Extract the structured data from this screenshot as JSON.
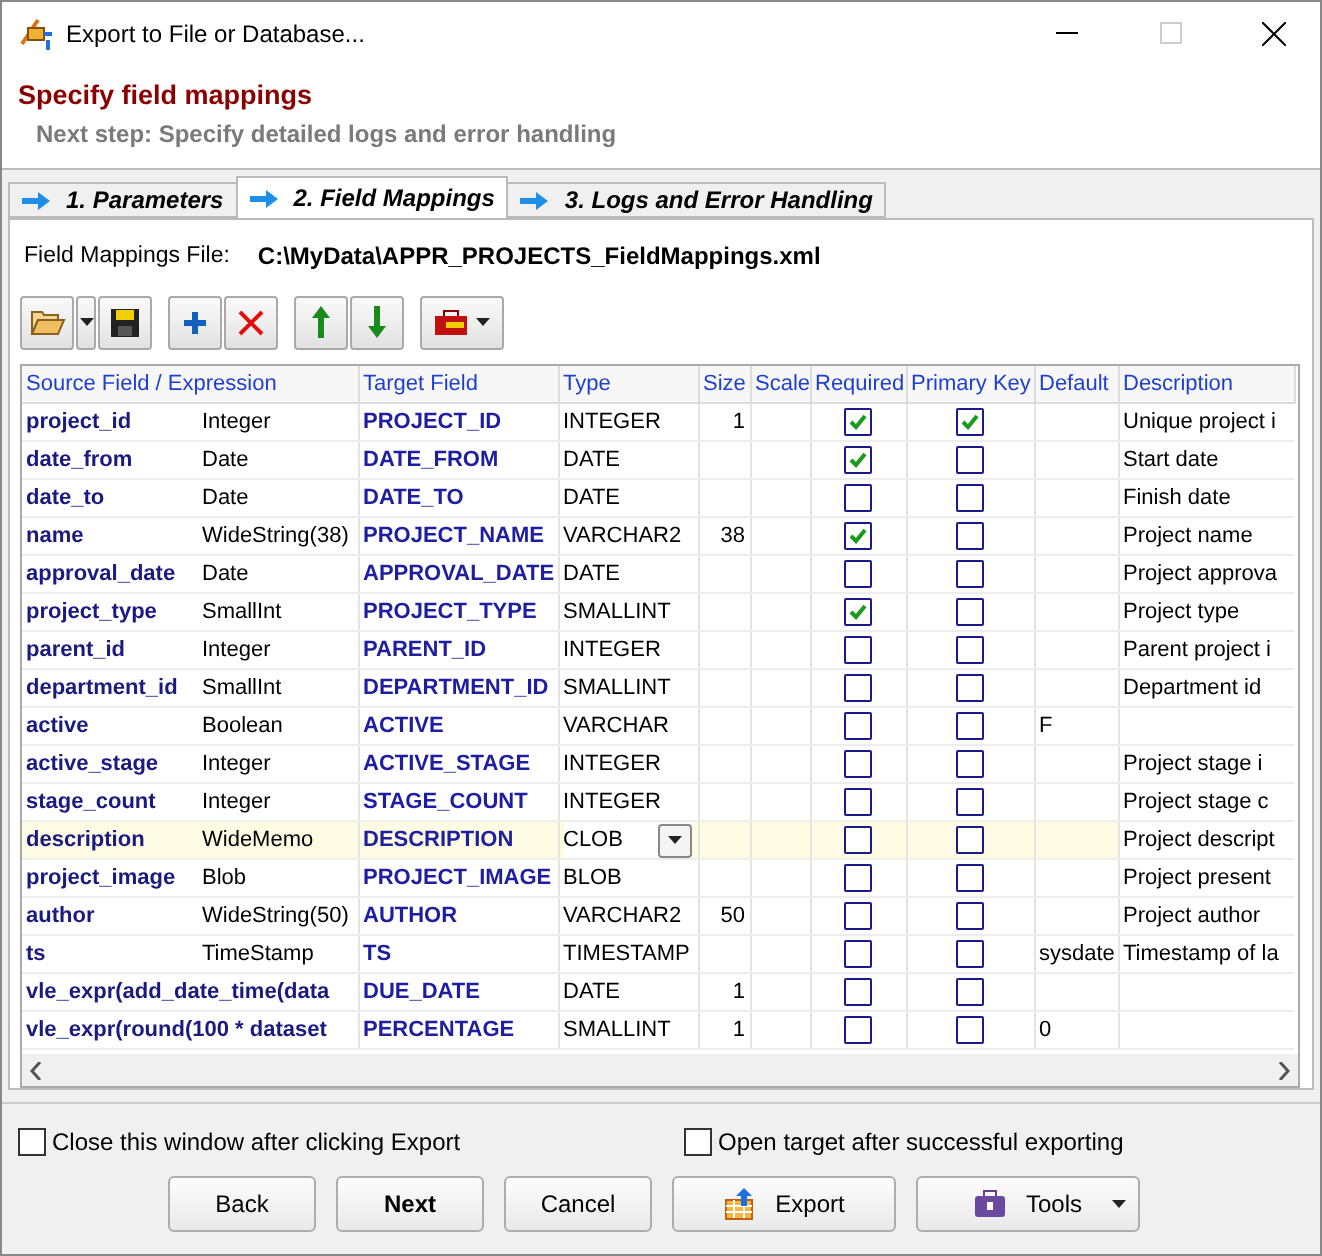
{
  "window": {
    "title": "Export to File or Database..."
  },
  "header": {
    "title": "Specify field mappings",
    "subtitle": "Next step: Specify detailed logs and error handling"
  },
  "tabs": [
    {
      "label": "1. Parameters",
      "selected": false
    },
    {
      "label": "2. Field Mappings",
      "selected": true
    },
    {
      "label": "3. Logs and Error Handling",
      "selected": false
    }
  ],
  "mappings_file": {
    "label": "Field Mappings File:",
    "value": "C:\\MyData\\APPR_PROJECTS_FieldMappings.xml"
  },
  "table": {
    "columns": [
      "Source Field / Expression",
      "Target Field",
      "Type",
      "Size",
      "Scale",
      "Required",
      "Primary Key",
      "Default",
      "Description"
    ],
    "rows": [
      {
        "source": "project_id",
        "source_type": "Integer",
        "target": "PROJECT_ID",
        "type": "INTEGER",
        "size": "1",
        "required": true,
        "primary_key": true,
        "description": "Unique project i",
        "selected": false
      },
      {
        "source": "date_from",
        "source_type": "Date",
        "target": "DATE_FROM",
        "type": "DATE",
        "required": true,
        "primary_key": false,
        "description": "Start date",
        "selected": false
      },
      {
        "source": "date_to",
        "source_type": "Date",
        "target": "DATE_TO",
        "type": "DATE",
        "required": false,
        "primary_key": false,
        "description": "Finish date",
        "selected": false
      },
      {
        "source": "name",
        "source_type": "WideString(38)",
        "target": "PROJECT_NAME",
        "type": "VARCHAR2",
        "size": "38",
        "required": true,
        "primary_key": false,
        "description": "Project name",
        "selected": false
      },
      {
        "source": "approval_date",
        "source_type": "Date",
        "target": "APPROVAL_DATE",
        "type": "DATE",
        "required": false,
        "primary_key": false,
        "description": "Project approva",
        "selected": false
      },
      {
        "source": "project_type",
        "source_type": "SmallInt",
        "target": "PROJECT_TYPE",
        "type": "SMALLINT",
        "required": true,
        "primary_key": false,
        "description": "Project type",
        "selected": false
      },
      {
        "source": "parent_id",
        "source_type": "Integer",
        "target": "PARENT_ID",
        "type": "INTEGER",
        "required": false,
        "primary_key": false,
        "description": "Parent project i",
        "selected": false
      },
      {
        "source": "department_id",
        "source_type": "SmallInt",
        "target": "DEPARTMENT_ID",
        "type": "SMALLINT",
        "required": false,
        "primary_key": false,
        "description": "Department id",
        "selected": false
      },
      {
        "source": "active",
        "source_type": "Boolean",
        "target": "ACTIVE",
        "type": "VARCHAR",
        "required": false,
        "primary_key": false,
        "default": "F",
        "selected": false
      },
      {
        "source": "active_stage",
        "source_type": "Integer",
        "target": "ACTIVE_STAGE",
        "type": "INTEGER",
        "required": false,
        "primary_key": false,
        "description": "Project stage i",
        "selected": false
      },
      {
        "source": "stage_count",
        "source_type": "Integer",
        "target": "STAGE_COUNT",
        "type": "INTEGER",
        "required": false,
        "primary_key": false,
        "description": "Project stage c",
        "selected": false
      },
      {
        "source": "description",
        "source_type": "WideMemo",
        "target": "DESCRIPTION",
        "type": "CLOB",
        "required": false,
        "primary_key": false,
        "description": "Project descript",
        "selected": true
      },
      {
        "source": "project_image",
        "source_type": "Blob",
        "target": "PROJECT_IMAGE",
        "type": "BLOB",
        "required": false,
        "primary_key": false,
        "description": "Project present",
        "selected": false
      },
      {
        "source": "author",
        "source_type": "WideString(50)",
        "target": "AUTHOR",
        "type": "VARCHAR2",
        "size": "50",
        "required": false,
        "primary_key": false,
        "description": "Project author",
        "selected": false
      },
      {
        "source": "ts",
        "source_type": "TimeStamp",
        "target": "TS",
        "type": "TIMESTAMP",
        "required": false,
        "primary_key": false,
        "default": "sysdate",
        "description": "Timestamp of la",
        "selected": false
      },
      {
        "source": "vle_expr(add_date_time(data",
        "target": "DUE_DATE",
        "type": "DATE",
        "size": "1",
        "required": false,
        "primary_key": false,
        "selected": false
      },
      {
        "source": "vle_expr(round(100 * dataset",
        "target": "PERCENTAGE",
        "type": "SMALLINT",
        "size": "1",
        "required": false,
        "primary_key": false,
        "default": "0",
        "selected": false
      }
    ]
  },
  "options": [
    {
      "label": "Close this window after clicking Export",
      "checked": false
    },
    {
      "label": "Open target after successful exporting",
      "checked": false
    }
  ],
  "buttons": [
    {
      "kind": "plain",
      "label": "Back"
    },
    {
      "kind": "default",
      "label": "Next"
    },
    {
      "kind": "plain",
      "label": "Cancel"
    },
    {
      "kind": "export",
      "label": "Export"
    },
    {
      "kind": "tools",
      "label": "Tools"
    }
  ]
}
